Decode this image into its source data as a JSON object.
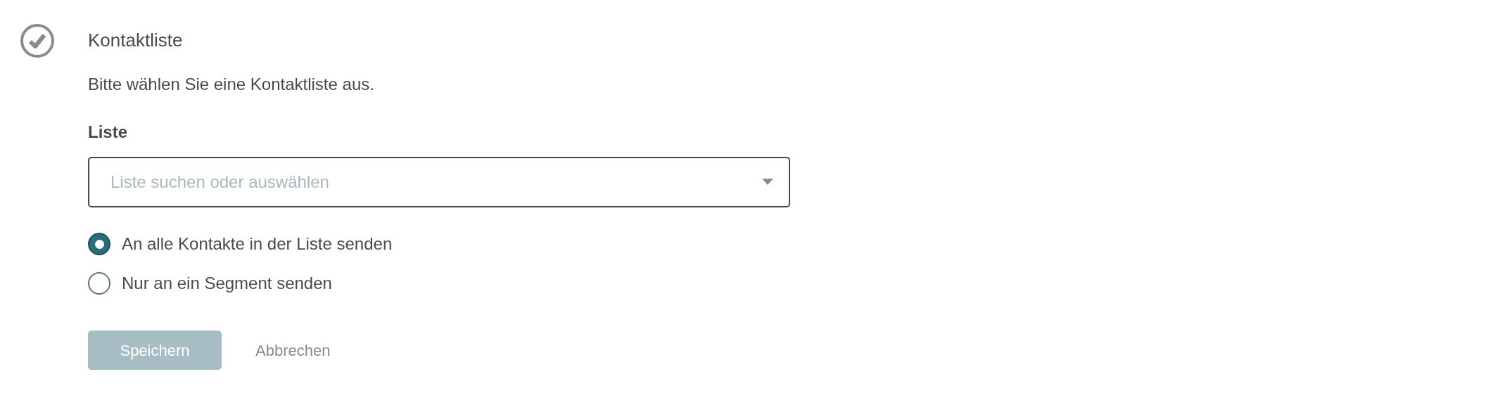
{
  "section": {
    "completed": true,
    "title": "Kontaktliste",
    "description": "Bitte wählen Sie eine Kontaktliste aus."
  },
  "list_field": {
    "label": "Liste",
    "placeholder": "Liste suchen oder auswählen"
  },
  "options": [
    {
      "label": "An alle Kontakte in der Liste senden",
      "selected": true
    },
    {
      "label": "Nur an ein Segment senden",
      "selected": false
    }
  ],
  "buttons": [
    {
      "kind": "primary",
      "label": "Speichern",
      "disabled": true
    },
    {
      "kind": "link",
      "label": "Abbrechen",
      "disabled": false
    }
  ]
}
